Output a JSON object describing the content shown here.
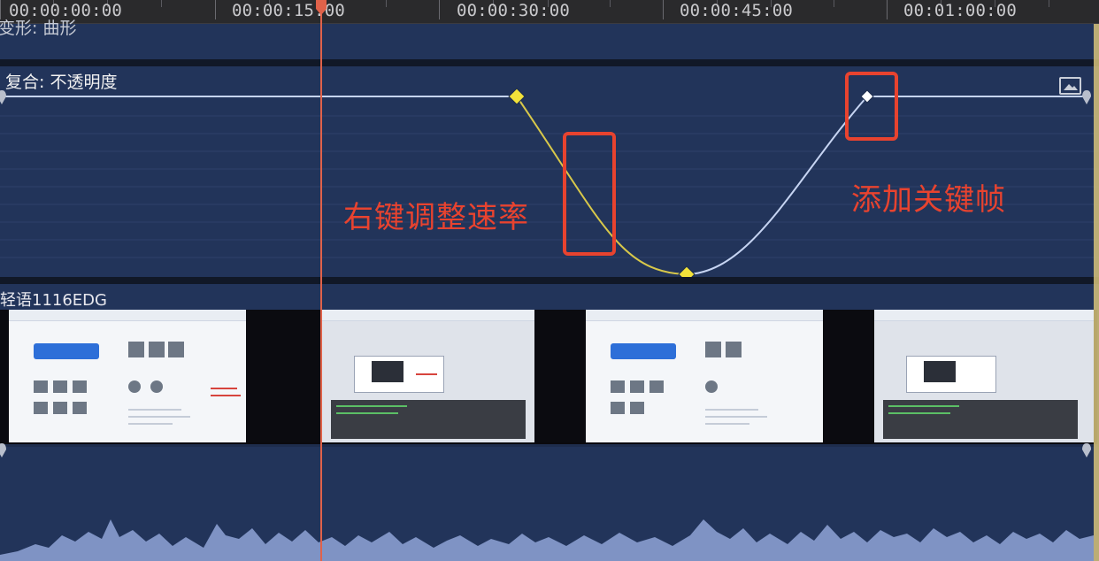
{
  "ruler": {
    "timecodes": [
      "00:00:00:00",
      "00:00:15:00",
      "00:00:30:00",
      "00:00:45:00",
      "00:01:00:00"
    ]
  },
  "top_lane": {
    "label": "变形: 曲形"
  },
  "animation_lane": {
    "title": "复合: 不透明度"
  },
  "annotations": {
    "adjust_speed": "右键调整速率",
    "add_keyframe": "添加关键帧"
  },
  "clip": {
    "label": "轻语1116EDG"
  },
  "colors": {
    "accent_annotation": "#e8432f",
    "playhead": "#e0624a",
    "keyframe_selected": "#f2e23a",
    "curve_eased": "#d8c84a",
    "curve_normal": "#c6d4f2",
    "lane_bg": "#22345a"
  },
  "icons": {
    "playhead_marker": "playhead-icon",
    "keyframe": "diamond-icon",
    "track_edge": "pin-icon",
    "lane_menu": "picture-icon"
  }
}
